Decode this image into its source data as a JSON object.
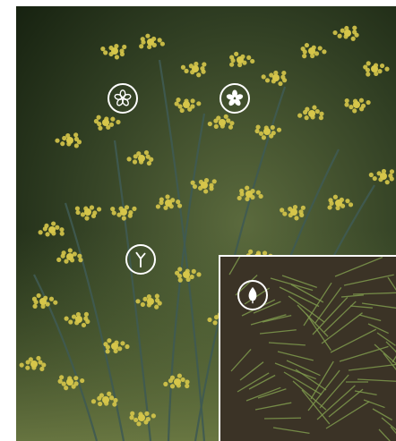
{
  "figure": {
    "markers": [
      {
        "name": "flower-outline-icon",
        "meaning": "flower"
      },
      {
        "name": "flower-filled-icon",
        "meaning": "flower"
      },
      {
        "name": "stem-icon",
        "meaning": "stem"
      },
      {
        "name": "leaf-icon",
        "meaning": "leaf"
      }
    ],
    "colors": {
      "marker_stroke": "#ffffff",
      "background_dark": "#1e2a1a",
      "flower_yellow": "#d6c64a",
      "stem_bluegreen": "#3f5a52",
      "foliage_green": "#7f9a4d",
      "inset_background": "#3b3326"
    }
  }
}
